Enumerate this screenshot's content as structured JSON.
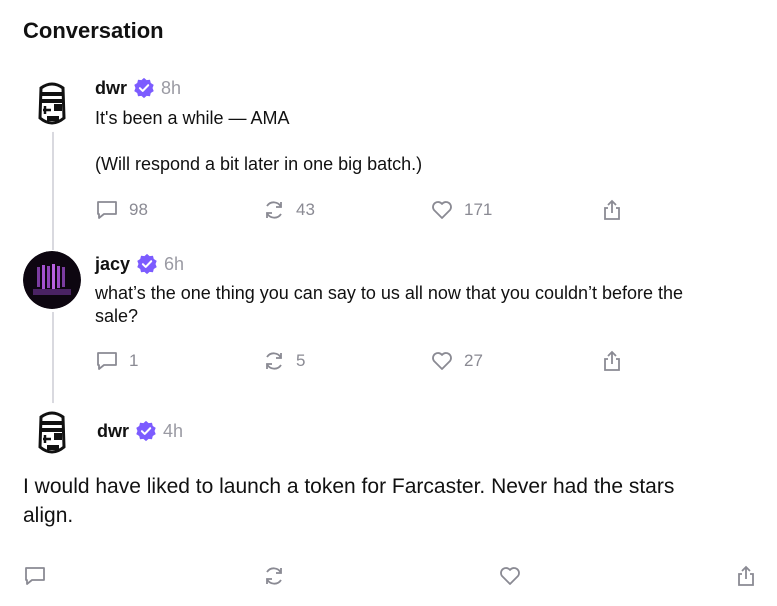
{
  "page": {
    "title": "Conversation"
  },
  "posts": [
    {
      "username": "dwr",
      "time": "8h",
      "text": "It's been a while — AMA\n\n(Will respond a bit later in one big batch.)",
      "replies": "98",
      "recasts": "43",
      "likes": "171"
    },
    {
      "username": "jacy",
      "time": "6h",
      "text": "what’s the one thing you can say to us all now that you couldn’t before the\nsale?",
      "replies": "1",
      "recasts": "5",
      "likes": "27"
    },
    {
      "username": "dwr",
      "time": "4h",
      "text": "I would have liked to launch a token for Farcaster. Never had the stars\nalign."
    }
  ],
  "colors": {
    "verified": "#7c5cff",
    "muted": "#8a8a93",
    "thread": "#d9d9df"
  },
  "icons": [
    "comment-icon",
    "recast-icon",
    "heart-icon",
    "share-icon",
    "verified-badge-icon"
  ]
}
